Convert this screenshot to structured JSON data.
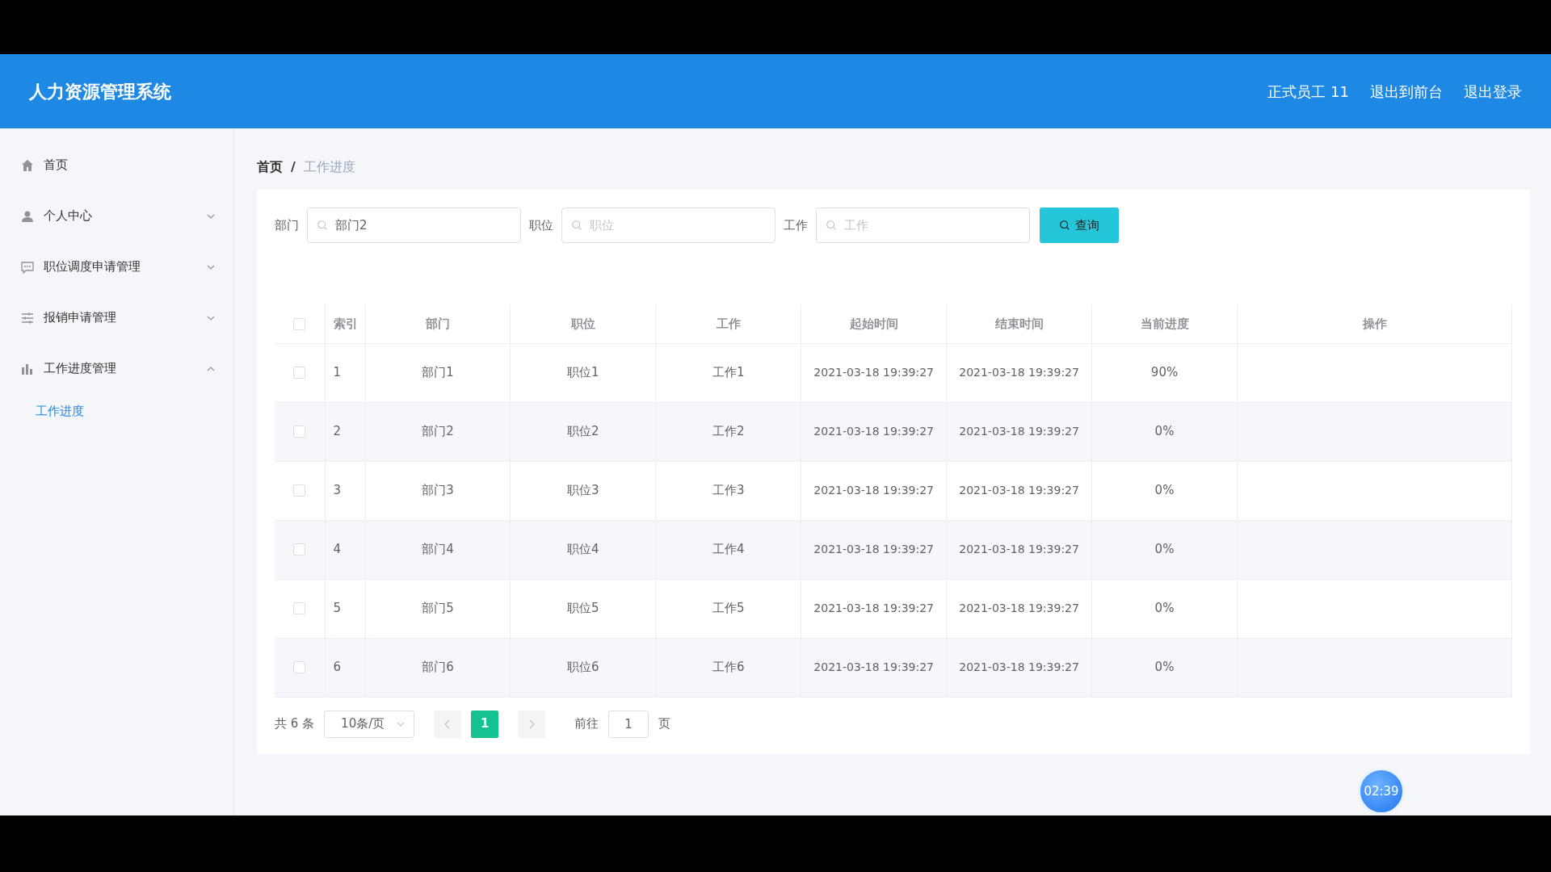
{
  "header": {
    "title": "人力资源管理系统",
    "links": [
      "正式员工 11",
      "退出到前台",
      "退出登录"
    ]
  },
  "sidebar": {
    "items": [
      {
        "label": "首页"
      },
      {
        "label": "个人中心",
        "expanded": false
      },
      {
        "label": "职位调度申请管理",
        "expanded": false
      },
      {
        "label": "报销申请管理",
        "expanded": false
      },
      {
        "label": "工作进度管理",
        "expanded": true,
        "children": [
          {
            "label": "工作进度",
            "selected": true
          }
        ]
      }
    ]
  },
  "breadcrumb": [
    "首页",
    "工作进度"
  ],
  "breadcrumb_separator": "/",
  "search": {
    "fields": [
      {
        "label": "部门",
        "value": "部门2"
      },
      {
        "label": "职位",
        "placeholder": "职位"
      },
      {
        "label": "工作",
        "placeholder": "工作"
      }
    ],
    "button": "查询"
  },
  "table": {
    "select_all": {
      "checked": false
    },
    "columns": [
      "索引",
      "部门",
      "职位",
      "工作",
      "起始时间",
      "结束时间",
      "当前进度",
      "操作"
    ],
    "rows": [
      {
        "checked": false,
        "cells": [
          "1",
          "部门1",
          "职位1",
          "工作1",
          "2021-03-18 19:39:27",
          "2021-03-18 19:39:27",
          "90%"
        ]
      },
      {
        "checked": false,
        "cells": [
          "2",
          "部门2",
          "职位2",
          "工作2",
          "2021-03-18 19:39:27",
          "2021-03-18 19:39:27",
          "0%"
        ]
      },
      {
        "checked": false,
        "cells": [
          "3",
          "部门3",
          "职位3",
          "工作3",
          "2021-03-18 19:39:27",
          "2021-03-18 19:39:27",
          "0%"
        ]
      },
      {
        "checked": false,
        "cells": [
          "4",
          "部门4",
          "职位4",
          "工作4",
          "2021-03-18 19:39:27",
          "2021-03-18 19:39:27",
          "0%"
        ]
      },
      {
        "checked": false,
        "cells": [
          "5",
          "部门5",
          "职位5",
          "工作5",
          "2021-03-18 19:39:27",
          "2021-03-18 19:39:27",
          "0%"
        ]
      },
      {
        "checked": false,
        "cells": [
          "6",
          "部门6",
          "职位6",
          "工作6",
          "2021-03-18 19:39:27",
          "2021-03-18 19:39:27",
          "0%"
        ]
      }
    ]
  },
  "pagination": {
    "total": "共 6 条",
    "page_size": "10条/页",
    "prev_disabled": true,
    "next_disabled": true,
    "pages": [
      {
        "label": "1",
        "selected": true
      }
    ],
    "goto_label": "前往",
    "goto_value": "1",
    "goto_suffix": "页"
  },
  "timer": "02:39"
}
